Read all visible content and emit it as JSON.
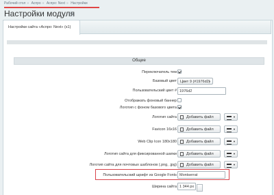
{
  "breadcrumbs": [
    "Рабочий стол",
    "Аспро",
    "Аспро: Next",
    "Настройки"
  ],
  "title": "Настройки модуля",
  "tab_label": "Настройки сайта «Аспро: Next» (s1)",
  "section_header": "Общие",
  "rows": {
    "theme_switcher": "Переключатель тем",
    "base_color": "Базовый цвет",
    "base_color_value": "Цвет 9 (#1976d2)",
    "custom_color": "Пользовательский цвет #",
    "custom_color_value": "1976d2",
    "bg_banner": "Отображать фоновый баннер",
    "logo_bg": "Логотип с фоном базового цвета",
    "site_logo": "Логотип сайта",
    "favicon": "Favicon 16x16",
    "webclip": "Web Clip Icon 180x180",
    "fixed_logo": "Логотип сайта для фиксированной шапки",
    "mail_logo": "Логотип сайта для почтовых шаблонов (.png, .jpg)",
    "google_font": "Пользовательский шрифт из Google Fonts",
    "google_font_value": "Montserrat",
    "site_width": "Ширина сайта",
    "site_width_value": "1 344 px"
  },
  "add_file_label": "Добавить файл",
  "colors": {
    "highlight": "#d8434a",
    "breadcrumb_underline": "#e04545"
  }
}
